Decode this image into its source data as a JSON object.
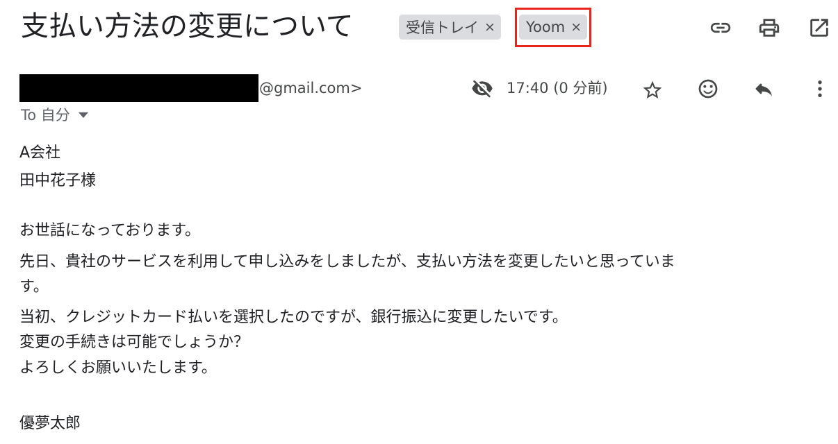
{
  "subject": "支払い方法の変更について",
  "labels": [
    {
      "text": "受信トレイ",
      "remove": "×"
    },
    {
      "text": "Yoom",
      "remove": "×"
    }
  ],
  "toolbar_icons": {
    "link": "link-icon",
    "print": "print-icon",
    "popout": "open-in-new-window-icon"
  },
  "message": {
    "sender_email_suffix": "@gmail.com>",
    "to_line": "To 自分",
    "timestamp": "17:40 (0 分前)",
    "icons": {
      "eye": "eye-off-icon",
      "star": "star-icon",
      "emoji": "emoji-reaction-icon",
      "reply": "reply-icon",
      "more": "more-vertical-icon"
    }
  },
  "body": {
    "line1": "A会社",
    "line2": "田中花子様",
    "line3": "お世話になっております。",
    "line4": " 先日、貴社のサービスを利用して申し込みをしましたが、支払い方法を変更したいと思っていま",
    "line5": "す。",
    "line6": " 当初、クレジットカード払いを選択したのですが、銀行振込に変更したいです。",
    "line7": " 変更の手続きは可能でしょうか？",
    "line8": "よろしくお願いいたします。",
    "line9": "優夢太郎"
  },
  "colors": {
    "highlight": "#e8241b",
    "chip_bg": "#dadce0",
    "text": "#202124",
    "muted": "#444746"
  }
}
